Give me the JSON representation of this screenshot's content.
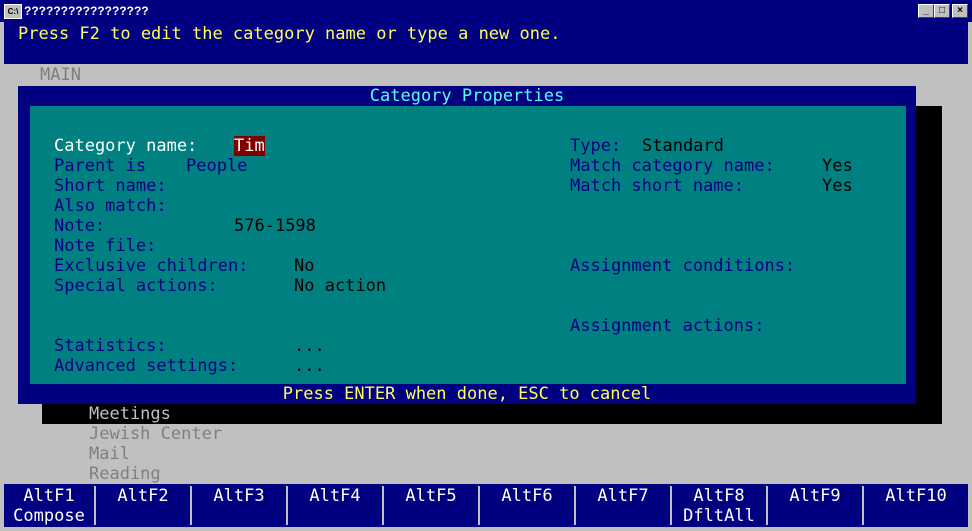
{
  "window": {
    "title": "?????????????????",
    "icon": "C:\\"
  },
  "hint": "Press F2 to edit the category name or type a new one.",
  "menu": {
    "main": "MAIN"
  },
  "dialog": {
    "title": "Category Properties",
    "footer": "Press ENTER when done, ESC to cancel",
    "fields": {
      "category_name_label": "Category name:",
      "category_name_value": "Tim",
      "parent_label": "Parent is",
      "parent_value": "People",
      "short_name_label": "Short name:",
      "also_match_label": "Also match:",
      "note_label": "Note:",
      "note_value": "576-1598",
      "note_file_label": "Note file:",
      "exclusive_children_label": "Exclusive children:",
      "exclusive_children_value": "No",
      "special_actions_label": "Special actions:",
      "special_actions_value": "No action",
      "statistics_label": "Statistics:",
      "statistics_value": "...",
      "advanced_settings_label": "Advanced settings:",
      "advanced_settings_value": "...",
      "type_label": "Type:",
      "type_value": "Standard",
      "match_category_name_label": "Match category name:",
      "match_category_name_value": "Yes",
      "match_short_name_label": "Match short name:",
      "match_short_name_value": "Yes",
      "assignment_conditions_label": "Assignment conditions:",
      "assignment_actions_label": "Assignment actions:"
    }
  },
  "background_list": [
    "Meetings",
    "Jewish Center",
    "Mail",
    "Reading"
  ],
  "function_keys": [
    {
      "key": "AltF1",
      "label": "Compose"
    },
    {
      "key": "AltF2",
      "label": ""
    },
    {
      "key": "AltF3",
      "label": ""
    },
    {
      "key": "AltF4",
      "label": ""
    },
    {
      "key": "AltF5",
      "label": ""
    },
    {
      "key": "AltF6",
      "label": ""
    },
    {
      "key": "AltF7",
      "label": ""
    },
    {
      "key": "AltF8",
      "label": "DfltAll"
    },
    {
      "key": "AltF9",
      "label": ""
    },
    {
      "key": "AltF10",
      "label": ""
    }
  ],
  "colors": {
    "console_blue": "#000080",
    "console_teal": "#008080",
    "hint_yellow": "#ffff55",
    "title_cyan": "#55ffff",
    "selection_red": "#800000"
  }
}
